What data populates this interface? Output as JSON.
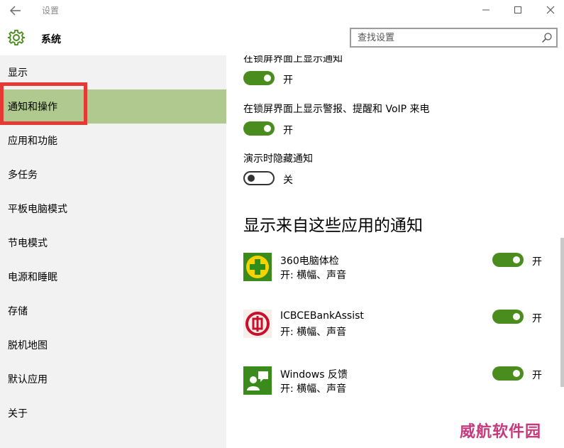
{
  "window": {
    "title": "设置"
  },
  "header": {
    "title": "系统",
    "search_placeholder": "查找设置"
  },
  "sidebar": {
    "items": [
      {
        "label": "显示"
      },
      {
        "label": "通知和操作"
      },
      {
        "label": "应用和功能"
      },
      {
        "label": "多任务"
      },
      {
        "label": "平板电脑模式"
      },
      {
        "label": "节电模式"
      },
      {
        "label": "电源和睡眠"
      },
      {
        "label": "存储"
      },
      {
        "label": "脱机地图"
      },
      {
        "label": "默认应用"
      },
      {
        "label": "关于"
      }
    ],
    "selected_index": 1
  },
  "content": {
    "options": [
      {
        "label": "在锁屏界面上显示通知",
        "state": "开",
        "on": true
      },
      {
        "label": "在锁屏界面上显示警报、提醒和 VoIP 来电",
        "state": "开",
        "on": true
      },
      {
        "label": "演示时隐藏通知",
        "state": "关",
        "on": false
      }
    ],
    "apps_heading": "显示来自这些应用的通知",
    "apps": [
      {
        "name": "360电脑体检",
        "detail": "开: 横幅、声音",
        "state": "开",
        "on": true,
        "icon": "360-check-icon"
      },
      {
        "name": "ICBCEBankAssist",
        "detail": "开: 横幅、声音",
        "state": "开",
        "on": true,
        "icon": "icbc-icon"
      },
      {
        "name": "Windows 反馈",
        "detail": "开: 横幅、声音",
        "state": "开",
        "on": true,
        "icon": "feedback-icon"
      }
    ]
  },
  "colors": {
    "accent": "#4b8c1f",
    "selected_bg": "#afc98f",
    "highlight_frame": "#e53935"
  },
  "watermark": "威航软件园"
}
